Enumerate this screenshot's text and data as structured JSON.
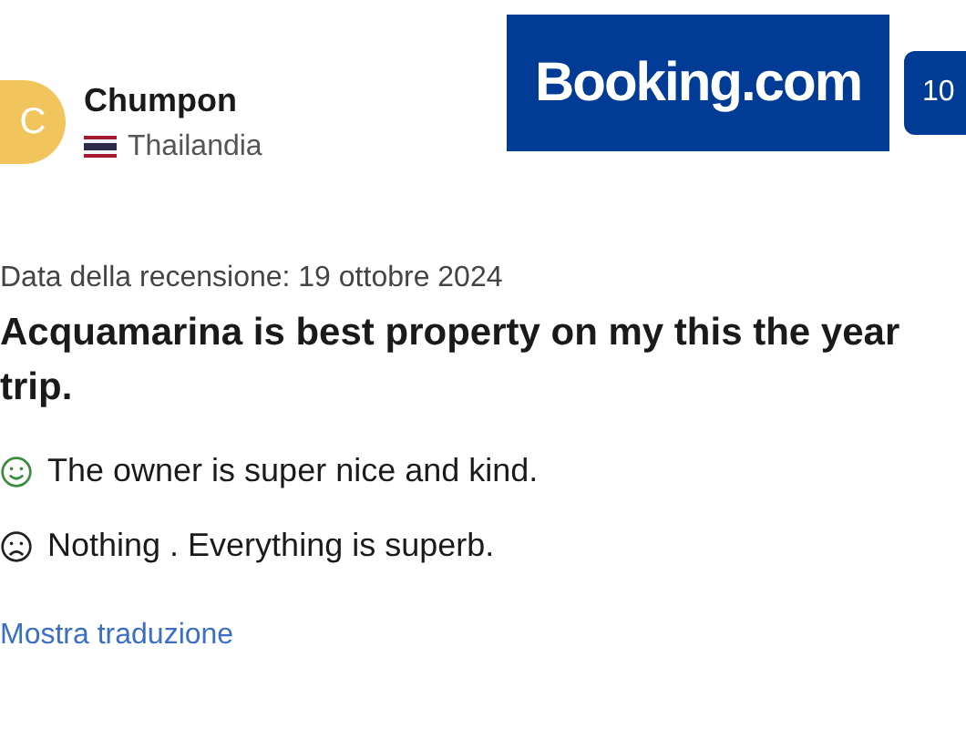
{
  "reviewer": {
    "initial": "C",
    "name": "Chumpon",
    "country": "Thailandia"
  },
  "logo": "Booking.com",
  "score": "10",
  "review_date": "Data della recensione: 19 ottobre 2024",
  "title": "Acquamarina is best property on my this the year trip.",
  "comments": [
    {
      "kind": "positive",
      "text": "The owner is super nice and kind."
    },
    {
      "kind": "negative",
      "text": "Nothing . Everything is superb."
    }
  ],
  "translate_link": "Mostra traduzione"
}
